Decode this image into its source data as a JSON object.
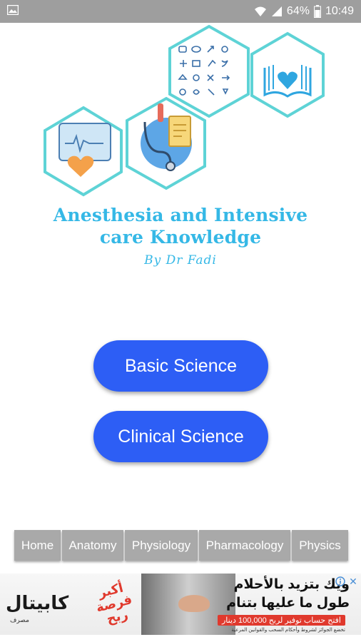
{
  "status_bar": {
    "battery": "64%",
    "time": "10:49",
    "icons": [
      "image-icon",
      "wifi-icon",
      "signal-icon",
      "battery-icon"
    ]
  },
  "logo": {
    "icons": [
      "ecg-monitor-icon",
      "stethoscope-clipboard-icon",
      "medical-symbols-grid-icon",
      "book-heart-icon"
    ],
    "accent_color": "#35b8e6",
    "hex_border_color": "#5ed3d6"
  },
  "title": {
    "line1": "Anesthesia and Intensive",
    "line2": "care Knowledge",
    "byline": "By Dr Fadi"
  },
  "buttons": {
    "basic": "Basic Science",
    "clinical": "Clinical Science",
    "color": "#2d5ef5"
  },
  "nav": [
    "Home",
    "Anatomy",
    "Physiology",
    "Pharmacology",
    "Physics"
  ],
  "ad": {
    "brand": "كابيتال",
    "brand_sub": "مصرف",
    "stamp": "أكبر فرصة ربح",
    "line1": "ويك بتزيد بالأحلام",
    "line2": "طول ما عليها بتنام",
    "cta": "افتح حساب توفير لربح 100,000 دينار",
    "fine": "تخضع الجوائز لشروط وأحكام السحب والقوانين المرعية",
    "icons": [
      "adchoices-icon",
      "close-icon"
    ]
  }
}
